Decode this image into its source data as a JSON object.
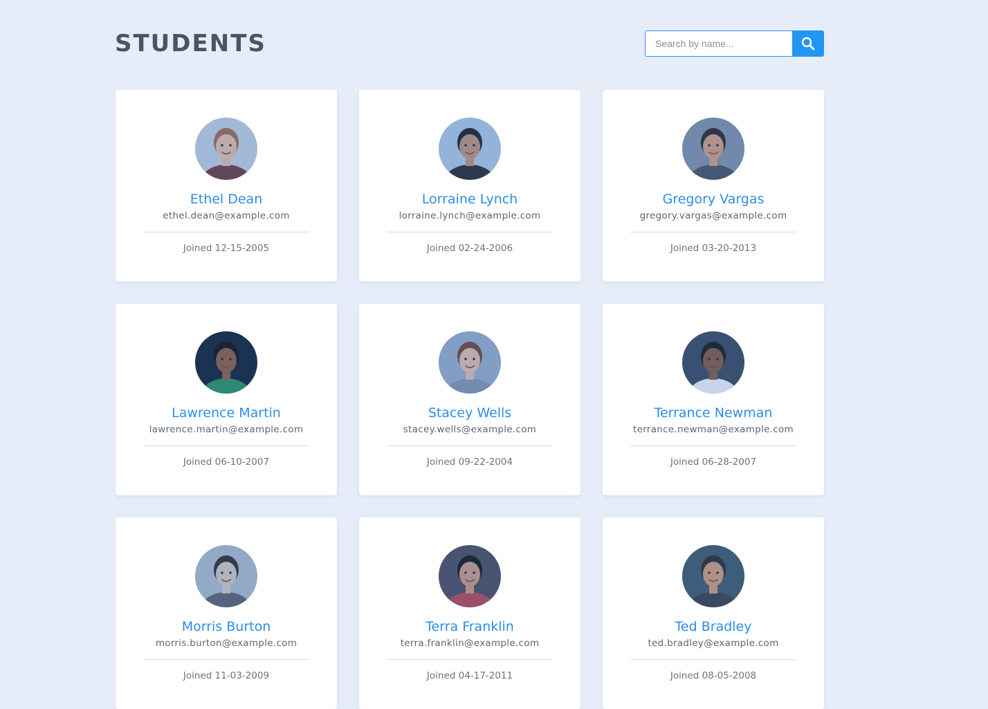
{
  "header": {
    "title": "STUDENTS"
  },
  "search": {
    "placeholder": "Search by name...",
    "value": "",
    "button_icon": "search-icon"
  },
  "colors": {
    "background": "#e6edf9",
    "accent": "#2196f3",
    "name_text": "#2d8ce8",
    "title_text": "#4a5468"
  },
  "students": [
    {
      "name": "Ethel Dean",
      "email": "ethel.dean@example.com",
      "joined": "Joined 12-15-2005",
      "avatar": {
        "bg": "#b9c9dd",
        "skin": "#d9b9a8",
        "hair": "#9b6a55",
        "shirt": "#6d3c48"
      }
    },
    {
      "name": "Lorraine Lynch",
      "email": "lorraine.lynch@example.com",
      "joined": "Joined 02-24-2006",
      "avatar": {
        "bg": "#a9c3e2",
        "skin": "#b98f7c",
        "hair": "#1e2430",
        "shirt": "#2a2e38"
      }
    },
    {
      "name": "Gregory Vargas",
      "email": "gregory.vargas@example.com",
      "joined": "Joined 03-20-2013",
      "avatar": {
        "bg": "#7e8fa8",
        "skin": "#c99a82",
        "hair": "#2b2a2e",
        "shirt": "#4a5366"
      }
    },
    {
      "name": "Lawrence Martin",
      "email": "lawrence.martin@example.com",
      "joined": "Joined 06-10-2007",
      "avatar": {
        "bg": "#15263d",
        "skin": "#8a5f48",
        "hair": "#141416",
        "shirt": "#2c8f63"
      }
    },
    {
      "name": "Stacey Wells",
      "email": "stacey.wells@example.com",
      "joined": "Joined 09-22-2004",
      "avatar": {
        "bg": "#93a9c7",
        "skin": "#d7b9ae",
        "hair": "#6a4a40",
        "shirt": "#7f93ad"
      }
    },
    {
      "name": "Terrance Newman",
      "email": "terrance.newman@example.com",
      "joined": "Joined 06-28-2007",
      "avatar": {
        "bg": "#3a4a63",
        "skin": "#7e5a46",
        "hair": "#1b1c20",
        "shirt": "#e8ecf3"
      }
    },
    {
      "name": "Morris Burton",
      "email": "morris.burton@example.com",
      "joined": "Joined 11-03-2009",
      "avatar": {
        "bg": "#a8b6c9",
        "skin": "#c9c2bf",
        "hair": "#2e3138",
        "shirt": "#5b6272"
      }
    },
    {
      "name": "Terra Franklin",
      "email": "terra.franklin@example.com",
      "joined": "Joined 04-17-2011",
      "avatar": {
        "bg": "#4c4f62",
        "skin": "#c49786",
        "hair": "#1a1a1f",
        "shirt": "#b04a5a"
      }
    },
    {
      "name": "Ted Bradley",
      "email": "ted.bradley@example.com",
      "joined": "Joined 08-05-2008",
      "avatar": {
        "bg": "#3f5a6d",
        "skin": "#c89a7e",
        "hair": "#2b2f33",
        "shirt": "#3a4150"
      }
    }
  ]
}
